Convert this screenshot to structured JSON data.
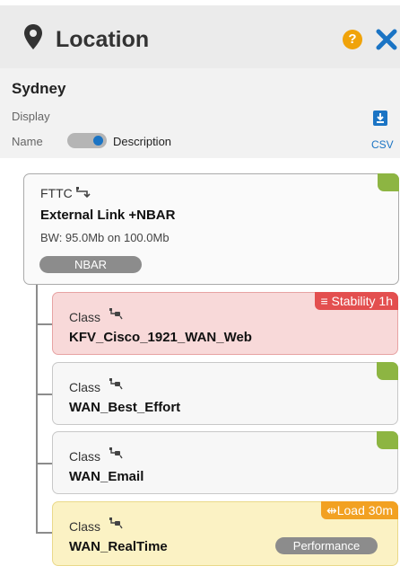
{
  "header": {
    "title": "Location",
    "help_glyph": "?",
    "icons": {
      "location": "map-pin-icon",
      "help": "help-icon",
      "close": "close-icon"
    }
  },
  "location": {
    "name": "Sydney",
    "display_label": "Display",
    "toggle_left_label": "Name",
    "toggle_right_label": "Description",
    "toggle_state": "Description",
    "export_label": "CSV"
  },
  "link": {
    "type": "FTTC",
    "name": "External Link +NBAR",
    "bandwidth": "BW: 95.0Mb on 100.0Mb",
    "tag": "NBAR",
    "status_color": "#8db542"
  },
  "classes": [
    {
      "label": "Class",
      "name": "KFV_Cisco_1921_WAN_Web",
      "alert": "Stability 1h",
      "alert_icon": "stability-icon",
      "alert_color": "#e34f4f",
      "tag": ""
    },
    {
      "label": "Class",
      "name": "WAN_Best_Effort",
      "alert": "",
      "status_color": "#8db542",
      "tag": ""
    },
    {
      "label": "Class",
      "name": "WAN_Email",
      "alert": "",
      "status_color": "#8db542",
      "tag": ""
    },
    {
      "label": "Class",
      "name": "WAN_RealTime",
      "alert": "Load 30m",
      "alert_icon": "load-icon",
      "alert_color": "#f2a122",
      "tag": "Performance"
    }
  ],
  "colors": {
    "accent_blue": "#1b74c4",
    "help_orange": "#f0a30a",
    "ok_green": "#8db542"
  }
}
